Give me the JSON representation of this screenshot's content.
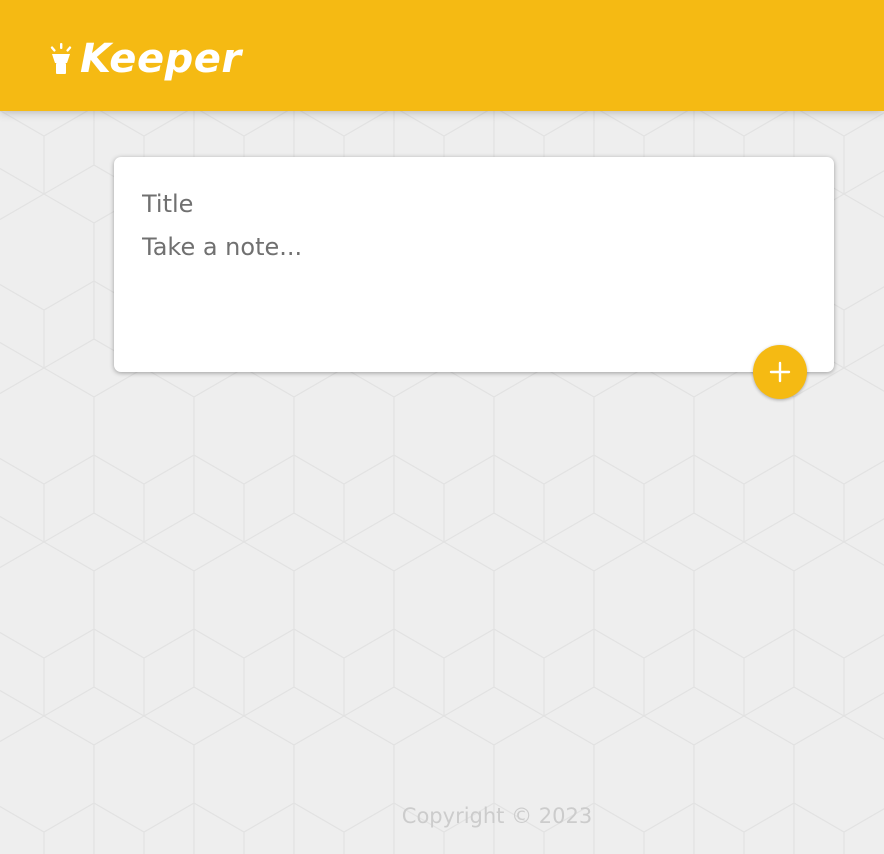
{
  "header": {
    "title": "Keeper",
    "logo_icon": "lamp-icon",
    "background_color": "#f5ba13"
  },
  "note_form": {
    "title_placeholder": "Title",
    "content_placeholder": "Take a note...",
    "add_button_icon": "plus-icon"
  },
  "footer": {
    "copyright": "Copyright © 2023"
  },
  "theme": {
    "accent": "#f5ba13",
    "background": "#eeeeee",
    "text_muted": "#cccccc"
  }
}
